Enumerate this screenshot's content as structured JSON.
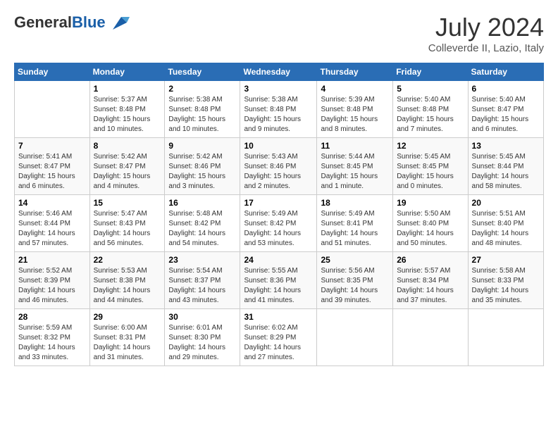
{
  "header": {
    "logo_general": "General",
    "logo_blue": "Blue",
    "month_title": "July 2024",
    "location": "Colleverde II, Lazio, Italy"
  },
  "weekdays": [
    "Sunday",
    "Monday",
    "Tuesday",
    "Wednesday",
    "Thursday",
    "Friday",
    "Saturday"
  ],
  "weeks": [
    [
      {
        "day": "",
        "info": ""
      },
      {
        "day": "1",
        "info": "Sunrise: 5:37 AM\nSunset: 8:48 PM\nDaylight: 15 hours\nand 10 minutes."
      },
      {
        "day": "2",
        "info": "Sunrise: 5:38 AM\nSunset: 8:48 PM\nDaylight: 15 hours\nand 10 minutes."
      },
      {
        "day": "3",
        "info": "Sunrise: 5:38 AM\nSunset: 8:48 PM\nDaylight: 15 hours\nand 9 minutes."
      },
      {
        "day": "4",
        "info": "Sunrise: 5:39 AM\nSunset: 8:48 PM\nDaylight: 15 hours\nand 8 minutes."
      },
      {
        "day": "5",
        "info": "Sunrise: 5:40 AM\nSunset: 8:48 PM\nDaylight: 15 hours\nand 7 minutes."
      },
      {
        "day": "6",
        "info": "Sunrise: 5:40 AM\nSunset: 8:47 PM\nDaylight: 15 hours\nand 6 minutes."
      }
    ],
    [
      {
        "day": "7",
        "info": "Sunrise: 5:41 AM\nSunset: 8:47 PM\nDaylight: 15 hours\nand 6 minutes."
      },
      {
        "day": "8",
        "info": "Sunrise: 5:42 AM\nSunset: 8:47 PM\nDaylight: 15 hours\nand 4 minutes."
      },
      {
        "day": "9",
        "info": "Sunrise: 5:42 AM\nSunset: 8:46 PM\nDaylight: 15 hours\nand 3 minutes."
      },
      {
        "day": "10",
        "info": "Sunrise: 5:43 AM\nSunset: 8:46 PM\nDaylight: 15 hours\nand 2 minutes."
      },
      {
        "day": "11",
        "info": "Sunrise: 5:44 AM\nSunset: 8:45 PM\nDaylight: 15 hours\nand 1 minute."
      },
      {
        "day": "12",
        "info": "Sunrise: 5:45 AM\nSunset: 8:45 PM\nDaylight: 15 hours\nand 0 minutes."
      },
      {
        "day": "13",
        "info": "Sunrise: 5:45 AM\nSunset: 8:44 PM\nDaylight: 14 hours\nand 58 minutes."
      }
    ],
    [
      {
        "day": "14",
        "info": "Sunrise: 5:46 AM\nSunset: 8:44 PM\nDaylight: 14 hours\nand 57 minutes."
      },
      {
        "day": "15",
        "info": "Sunrise: 5:47 AM\nSunset: 8:43 PM\nDaylight: 14 hours\nand 56 minutes."
      },
      {
        "day": "16",
        "info": "Sunrise: 5:48 AM\nSunset: 8:42 PM\nDaylight: 14 hours\nand 54 minutes."
      },
      {
        "day": "17",
        "info": "Sunrise: 5:49 AM\nSunset: 8:42 PM\nDaylight: 14 hours\nand 53 minutes."
      },
      {
        "day": "18",
        "info": "Sunrise: 5:49 AM\nSunset: 8:41 PM\nDaylight: 14 hours\nand 51 minutes."
      },
      {
        "day": "19",
        "info": "Sunrise: 5:50 AM\nSunset: 8:40 PM\nDaylight: 14 hours\nand 50 minutes."
      },
      {
        "day": "20",
        "info": "Sunrise: 5:51 AM\nSunset: 8:40 PM\nDaylight: 14 hours\nand 48 minutes."
      }
    ],
    [
      {
        "day": "21",
        "info": "Sunrise: 5:52 AM\nSunset: 8:39 PM\nDaylight: 14 hours\nand 46 minutes."
      },
      {
        "day": "22",
        "info": "Sunrise: 5:53 AM\nSunset: 8:38 PM\nDaylight: 14 hours\nand 44 minutes."
      },
      {
        "day": "23",
        "info": "Sunrise: 5:54 AM\nSunset: 8:37 PM\nDaylight: 14 hours\nand 43 minutes."
      },
      {
        "day": "24",
        "info": "Sunrise: 5:55 AM\nSunset: 8:36 PM\nDaylight: 14 hours\nand 41 minutes."
      },
      {
        "day": "25",
        "info": "Sunrise: 5:56 AM\nSunset: 8:35 PM\nDaylight: 14 hours\nand 39 minutes."
      },
      {
        "day": "26",
        "info": "Sunrise: 5:57 AM\nSunset: 8:34 PM\nDaylight: 14 hours\nand 37 minutes."
      },
      {
        "day": "27",
        "info": "Sunrise: 5:58 AM\nSunset: 8:33 PM\nDaylight: 14 hours\nand 35 minutes."
      }
    ],
    [
      {
        "day": "28",
        "info": "Sunrise: 5:59 AM\nSunset: 8:32 PM\nDaylight: 14 hours\nand 33 minutes."
      },
      {
        "day": "29",
        "info": "Sunrise: 6:00 AM\nSunset: 8:31 PM\nDaylight: 14 hours\nand 31 minutes."
      },
      {
        "day": "30",
        "info": "Sunrise: 6:01 AM\nSunset: 8:30 PM\nDaylight: 14 hours\nand 29 minutes."
      },
      {
        "day": "31",
        "info": "Sunrise: 6:02 AM\nSunset: 8:29 PM\nDaylight: 14 hours\nand 27 minutes."
      },
      {
        "day": "",
        "info": ""
      },
      {
        "day": "",
        "info": ""
      },
      {
        "day": "",
        "info": ""
      }
    ]
  ]
}
